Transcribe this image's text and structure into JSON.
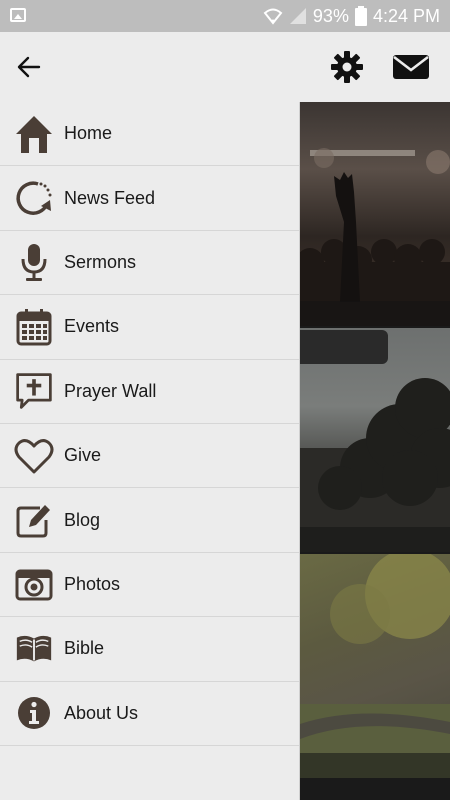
{
  "status_bar": {
    "battery": "93%",
    "time": "4:24 PM"
  },
  "app_bar": {
    "back_icon": "arrow-left-icon",
    "settings_icon": "gear-icon",
    "mail_icon": "envelope-icon"
  },
  "menu": {
    "items": [
      {
        "label": "Home",
        "icon": "house-icon"
      },
      {
        "label": "News Feed",
        "icon": "refresh-feed-icon"
      },
      {
        "label": "Sermons",
        "icon": "microphone-icon"
      },
      {
        "label": "Events",
        "icon": "calendar-icon"
      },
      {
        "label": "Prayer Wall",
        "icon": "cross-speech-bubble-icon"
      },
      {
        "label": "Give",
        "icon": "heart-icon"
      },
      {
        "label": "Blog",
        "icon": "edit-pencil-icon"
      },
      {
        "label": "Photos",
        "icon": "camera-icon"
      },
      {
        "label": "Bible",
        "icon": "open-book-icon"
      },
      {
        "label": "About Us",
        "icon": "info-icon"
      }
    ]
  },
  "colors": {
    "icon_brown": "#4a3e36",
    "drawer_bg": "#ececec",
    "status_bar_bg": "#bdbdbd"
  }
}
